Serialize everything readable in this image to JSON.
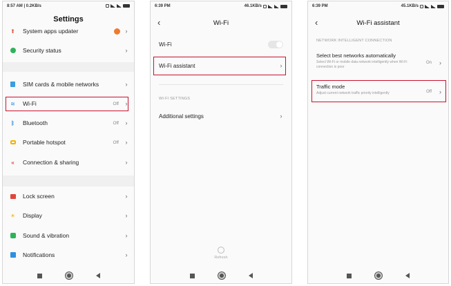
{
  "screen1": {
    "status_left": "8:57 AM | 0.2KB/s",
    "title": "Settings",
    "rows": [
      {
        "label": "System apps updater",
        "value": ""
      },
      {
        "label": "Security status",
        "value": ""
      },
      {
        "label": "SIM cards & mobile networks",
        "value": ""
      },
      {
        "label": "Wi-Fi",
        "value": "Off"
      },
      {
        "label": "Bluetooth",
        "value": "Off"
      },
      {
        "label": "Portable hotspot",
        "value": "Off"
      },
      {
        "label": "Connection & sharing",
        "value": ""
      },
      {
        "label": "Lock screen",
        "value": ""
      },
      {
        "label": "Display",
        "value": ""
      },
      {
        "label": "Sound & vibration",
        "value": ""
      },
      {
        "label": "Notifications",
        "value": ""
      }
    ]
  },
  "screen2": {
    "status_time": "6:39 PM",
    "status_speed": "46.1KB/s",
    "title": "Wi-Fi",
    "wifi_label": "Wi-Fi",
    "assistant_label": "Wi-Fi assistant",
    "section": "WI-FI SETTINGS",
    "additional_label": "Additional settings",
    "refresh_label": "Refresh"
  },
  "screen3": {
    "status_time": "6:39 PM",
    "status_speed": "45.1KB/s",
    "title": "Wi-Fi assistant",
    "section": "NETWORK INTELLIGENT CONNECTION",
    "best_title": "Select best networks automatically",
    "best_sub": "Select Wi-Fi or mobile data network intelligently when Wi-Fi connection is poor",
    "best_value": "On",
    "traffic_title": "Traffic mode",
    "traffic_sub": "Adjust current network traffic priority intelligently",
    "traffic_value": "Off"
  },
  "colors": {
    "highlight": "#c8102e"
  },
  "icons": [
    "arrow-up-icon",
    "shield-icon",
    "sim-icon",
    "wifi-icon",
    "bluetooth-icon",
    "hotspot-icon",
    "share-icon",
    "lock-icon",
    "sun-icon",
    "sound-icon",
    "bell-icon"
  ]
}
